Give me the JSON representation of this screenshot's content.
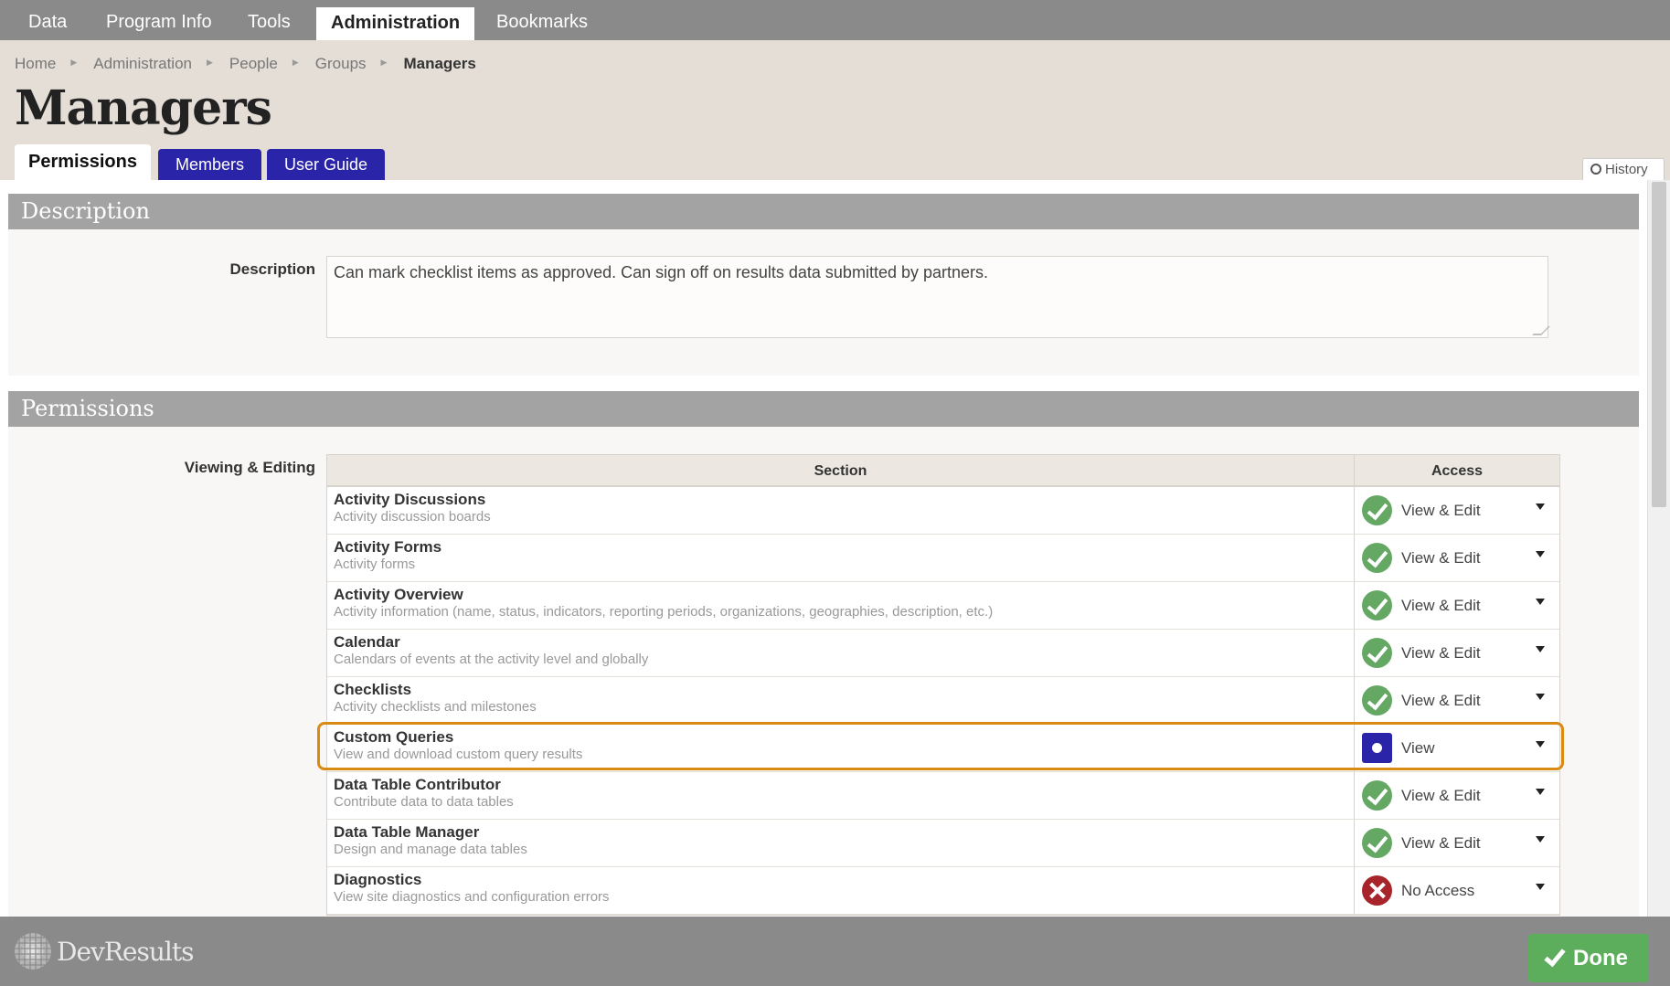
{
  "nav": {
    "items": [
      {
        "label": "Data"
      },
      {
        "label": "Program Info"
      },
      {
        "label": "Tools"
      },
      {
        "label": "Administration"
      },
      {
        "label": "Bookmarks"
      }
    ]
  },
  "breadcrumb": [
    "Home",
    "Administration",
    "People",
    "Groups",
    "Managers"
  ],
  "page_title": "Managers",
  "tabs": [
    {
      "label": "Permissions"
    },
    {
      "label": "Members"
    },
    {
      "label": "User Guide"
    }
  ],
  "history_label": "History",
  "description_section": {
    "header": "Description",
    "field_label": "Description",
    "value": "Can mark checklist items as approved. Can sign off on results data submitted by partners."
  },
  "permissions_section": {
    "header": "Permissions",
    "field_label": "Viewing & Editing",
    "col_section": "Section",
    "col_access": "Access",
    "rows": [
      {
        "name": "Activity Discussions",
        "desc": "Activity discussion boards",
        "access": "View & Edit",
        "icon": "check-circle-icon"
      },
      {
        "name": "Activity Forms",
        "desc": "Activity forms",
        "access": "View & Edit",
        "icon": "check-circle-icon"
      },
      {
        "name": "Activity Overview",
        "desc": "Activity information (name, status, indicators, reporting periods, organizations, geographies, description, etc.)",
        "access": "View & Edit",
        "icon": "check-circle-icon"
      },
      {
        "name": "Calendar",
        "desc": "Calendars of events at the activity level and globally",
        "access": "View & Edit",
        "icon": "check-circle-icon"
      },
      {
        "name": "Checklists",
        "desc": "Activity checklists and milestones",
        "access": "View & Edit",
        "icon": "check-circle-icon"
      },
      {
        "name": "Custom Queries",
        "desc": "View and download custom query results",
        "access": "View",
        "icon": "view-dot-icon"
      },
      {
        "name": "Data Table Contributor",
        "desc": "Contribute data to data tables",
        "access": "View & Edit",
        "icon": "check-circle-icon"
      },
      {
        "name": "Data Table Manager",
        "desc": "Design and manage data tables",
        "access": "View & Edit",
        "icon": "check-circle-icon"
      },
      {
        "name": "Diagnostics",
        "desc": "View site diagnostics and configuration errors",
        "access": "No Access",
        "icon": "x-circle-icon"
      }
    ]
  },
  "footer": {
    "logo_text": "DevResults",
    "done_label": "Done"
  },
  "colors": {
    "nav_bg": "#8a8a8a",
    "tab_blue": "#2a25a8",
    "check_green": "#64a864",
    "no_access_red": "#a8242b",
    "highlight_orange": "#d98a12",
    "done_green": "#5cad5c"
  }
}
